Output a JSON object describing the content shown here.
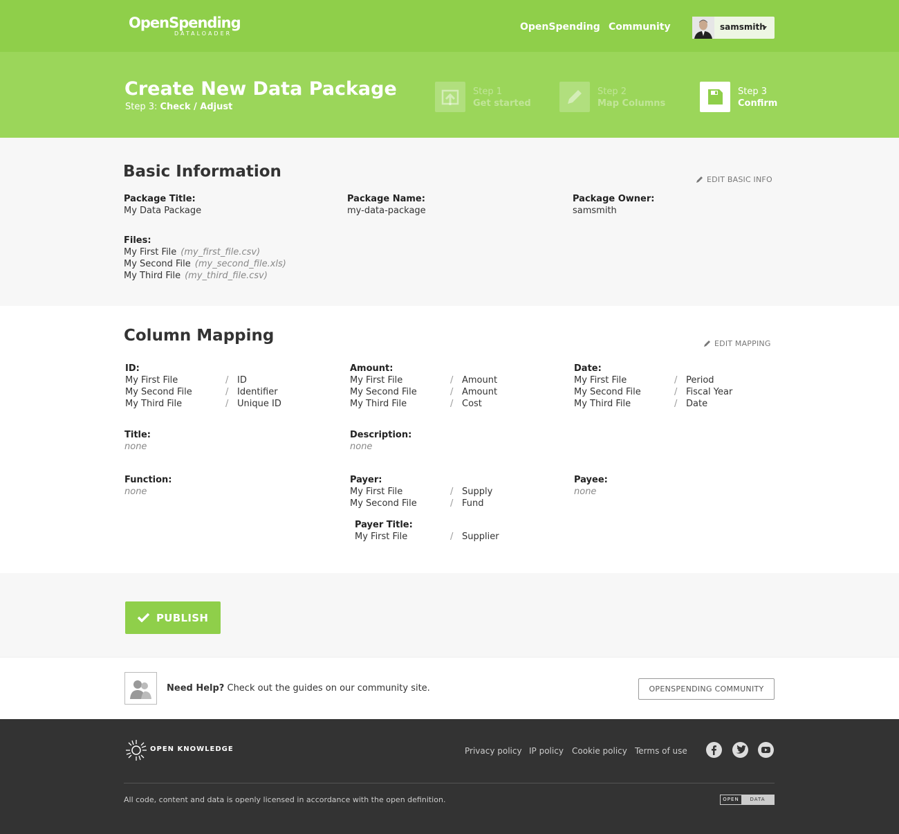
{
  "nav": {
    "logo_main": "OpenSpending",
    "logo_sub": "DATALOADER",
    "links": [
      "OpenSpending",
      "Community"
    ],
    "user": "samsmith"
  },
  "header": {
    "title": "Create New Data Package",
    "subtitle_prefix": "Step 3: ",
    "subtitle_strong": "Check / Adjust",
    "steps": [
      {
        "line1": "Step 1",
        "line2": "Get started",
        "icon": "upload-icon",
        "state": "inactive"
      },
      {
        "line1": "Step 2",
        "line2": "Map Columns",
        "icon": "pencil-icon",
        "state": "inactive"
      },
      {
        "line1": "Step 3",
        "line2": "Confirm",
        "icon": "save-icon",
        "state": "active"
      }
    ]
  },
  "basic": {
    "heading": "Basic Information",
    "edit_label": "EDIT BASIC INFO",
    "package_title_label": "Package Title:",
    "package_title": "My Data Package",
    "package_name_label": "Package Name:",
    "package_name": "my-data-package",
    "package_owner_label": "Package Owner:",
    "package_owner": "samsmith",
    "files_label": "Files:",
    "files": [
      {
        "name": "My First File",
        "file": "(my_first_file.csv)"
      },
      {
        "name": "My Second File",
        "file": "(my_second_file.xls)"
      },
      {
        "name": "My Third File",
        "file": "(my_third_file.csv)"
      }
    ]
  },
  "mapping": {
    "heading": "Column Mapping",
    "edit_label": "EDIT MAPPING",
    "sep": "/",
    "id": {
      "label": "ID:",
      "rows": [
        {
          "src": "My First File",
          "dst": "ID"
        },
        {
          "src": "My Second File",
          "dst": "Identifier"
        },
        {
          "src": "My Third File",
          "dst": "Unique ID"
        }
      ]
    },
    "amount": {
      "label": "Amount:",
      "rows": [
        {
          "src": "My First File",
          "dst": "Amount"
        },
        {
          "src": "My Second File",
          "dst": "Amount"
        },
        {
          "src": "My Third File",
          "dst": "Cost"
        }
      ]
    },
    "date": {
      "label": "Date:",
      "rows": [
        {
          "src": "My First File",
          "dst": "Period"
        },
        {
          "src": "My Second File",
          "dst": "Fiscal Year"
        },
        {
          "src": "My Third File",
          "dst": "Date"
        }
      ]
    },
    "title": {
      "label": "Title:",
      "value": "none"
    },
    "description": {
      "label": "Description:",
      "value": "none"
    },
    "function": {
      "label": "Function:",
      "value": "none"
    },
    "payer": {
      "label": "Payer:",
      "rows": [
        {
          "src": "My First File",
          "dst": "Supply"
        },
        {
          "src": "My Second File",
          "dst": "Fund"
        }
      ]
    },
    "payer_title": {
      "label": "Payer Title:",
      "rows": [
        {
          "src": "My First File",
          "dst": "Supplier"
        }
      ]
    },
    "payee": {
      "label": "Payee:",
      "value": "none"
    }
  },
  "publish": {
    "label": "PUBLISH"
  },
  "help": {
    "strong": "Need Help?",
    "text": " Check out the guides on our community site.",
    "button": "OPENSPENDING COMMUNITY"
  },
  "footer": {
    "brand": "OPEN KNOWLEDGE",
    "links": [
      "Privacy policy",
      "IP policy",
      "Cookie policy",
      "Terms of use"
    ],
    "social": [
      "facebook-icon",
      "twitter-icon",
      "youtube-icon"
    ],
    "license": "All code, content and data is openly licensed in accordance with the open definition.",
    "badge_a": "OPEN",
    "badge_b": "DATA"
  },
  "colors": {
    "brand_green": "#8fcf4a",
    "header_green": "#9bd65a",
    "footer_bg": "#333333"
  }
}
